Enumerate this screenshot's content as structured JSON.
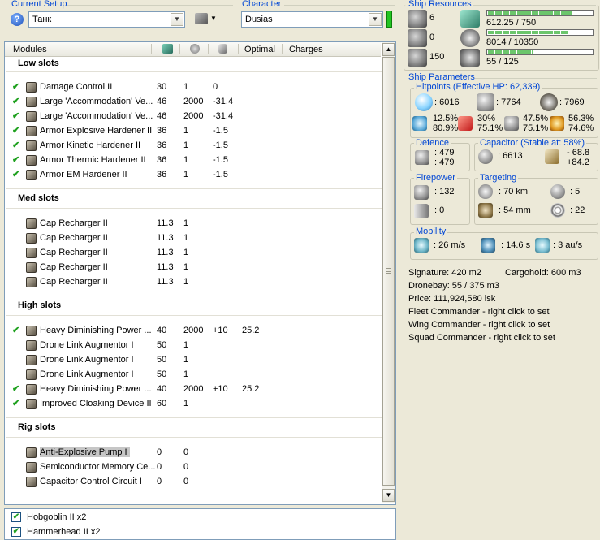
{
  "current_setup": {
    "title": "Current Setup",
    "value": "Танк"
  },
  "character": {
    "title": "Character",
    "value": "Dusias"
  },
  "ship_resources": {
    "title": "Ship Resources",
    "turrets": "6",
    "launchers": "0",
    "drone_bay": "150",
    "cpu_text": "612.25 / 750",
    "cpu_fraction": 0.816,
    "powergrid_text": "8014 / 10350",
    "powergrid_fraction": 0.774,
    "calibration_text": "55 / 125",
    "calibration_fraction": 0.44
  },
  "modules_table": {
    "headers": {
      "modules": "Modules",
      "optimal": "Optimal",
      "charges": "Charges"
    },
    "sections": [
      {
        "title": "Low slots",
        "rows": [
          {
            "checked": true,
            "name": "Damage Control II",
            "c1": "30",
            "c2": "1",
            "c3": "0",
            "optimal": ""
          },
          {
            "checked": true,
            "name": "Large 'Accommodation' Ve...",
            "c1": "46",
            "c2": "2000",
            "c3": "-31.4",
            "optimal": ""
          },
          {
            "checked": true,
            "name": "Large 'Accommodation' Ve...",
            "c1": "46",
            "c2": "2000",
            "c3": "-31.4",
            "optimal": ""
          },
          {
            "checked": true,
            "name": "Armor Explosive Hardener II",
            "c1": "36",
            "c2": "1",
            "c3": "-1.5",
            "optimal": ""
          },
          {
            "checked": true,
            "name": "Armor Kinetic Hardener II",
            "c1": "36",
            "c2": "1",
            "c3": "-1.5",
            "optimal": ""
          },
          {
            "checked": true,
            "name": "Armor Thermic Hardener II",
            "c1": "36",
            "c2": "1",
            "c3": "-1.5",
            "optimal": ""
          },
          {
            "checked": true,
            "name": "Armor EM Hardener II",
            "c1": "36",
            "c2": "1",
            "c3": "-1.5",
            "optimal": ""
          }
        ]
      },
      {
        "title": "Med slots",
        "rows": [
          {
            "checked": false,
            "name": "Cap Recharger II",
            "c1": "11.3",
            "c2": "1",
            "c3": "",
            "optimal": ""
          },
          {
            "checked": false,
            "name": "Cap Recharger II",
            "c1": "11.3",
            "c2": "1",
            "c3": "",
            "optimal": ""
          },
          {
            "checked": false,
            "name": "Cap Recharger II",
            "c1": "11.3",
            "c2": "1",
            "c3": "",
            "optimal": ""
          },
          {
            "checked": false,
            "name": "Cap Recharger II",
            "c1": "11.3",
            "c2": "1",
            "c3": "",
            "optimal": ""
          },
          {
            "checked": false,
            "name": "Cap Recharger II",
            "c1": "11.3",
            "c2": "1",
            "c3": "",
            "optimal": ""
          }
        ]
      },
      {
        "title": "High slots",
        "rows": [
          {
            "checked": true,
            "name": "Heavy Diminishing Power ...",
            "c1": "40",
            "c2": "2000",
            "c3": "+10",
            "optimal": "25.2"
          },
          {
            "checked": false,
            "name": "Drone Link Augmentor I",
            "c1": "50",
            "c2": "1",
            "c3": "",
            "optimal": ""
          },
          {
            "checked": false,
            "name": "Drone Link Augmentor I",
            "c1": "50",
            "c2": "1",
            "c3": "",
            "optimal": ""
          },
          {
            "checked": false,
            "name": "Drone Link Augmentor I",
            "c1": "50",
            "c2": "1",
            "c3": "",
            "optimal": ""
          },
          {
            "checked": true,
            "name": "Heavy Diminishing Power ...",
            "c1": "40",
            "c2": "2000",
            "c3": "+10",
            "optimal": "25.2"
          },
          {
            "checked": true,
            "name": "Improved Cloaking Device II",
            "c1": "60",
            "c2": "1",
            "c3": "",
            "optimal": ""
          }
        ]
      },
      {
        "title": "Rig slots",
        "rows": [
          {
            "checked": false,
            "name": "Anti-Explosive Pump I",
            "c1": "0",
            "c2": "0",
            "c3": "",
            "optimal": "",
            "selected": true
          },
          {
            "checked": false,
            "name": "Semiconductor Memory Ce...",
            "c1": "0",
            "c2": "0",
            "c3": "",
            "optimal": ""
          },
          {
            "checked": false,
            "name": "Capacitor Control Circuit I",
            "c1": "0",
            "c2": "0",
            "c3": "",
            "optimal": ""
          }
        ]
      }
    ]
  },
  "drones": [
    {
      "label": "Hobgoblin II x2",
      "checked": true
    },
    {
      "label": "Hammerhead II x2",
      "checked": true
    }
  ],
  "ship_parameters": {
    "title": "Ship Parameters",
    "hitpoints": {
      "title": "Hitpoints (Effective HP: 62,339)",
      "shield": ": 6016",
      "armor": ": 7764",
      "hull": ": 7969",
      "res_em": "12.5%\n80.9%",
      "res_em_top": "12.5%",
      "res_em_bottom": "80.9%",
      "res_thermal_top": "30%",
      "res_thermal_bottom": "75.1%",
      "res_kinetic_top": "47.5%",
      "res_kinetic_bottom": "75.1%",
      "res_explosive_top": "56.3%",
      "res_explosive_bottom": "74.6%"
    },
    "defence": {
      "title": "Defence",
      "top": ": 479",
      "bottom": ": 479"
    },
    "capacitor": {
      "title": "Capacitor (Stable at: 58%)",
      "amount": ": 6613",
      "top": "- 68.8",
      "bottom": "+84.2"
    },
    "firepower": {
      "title": "Firepower",
      "turret": ": 132",
      "missile": ": 0"
    },
    "targeting": {
      "title": "Targeting",
      "range": ": 70 km",
      "targets": ": 5",
      "scan_res": ": 54 mm",
      "sensor": ": 22"
    },
    "mobility": {
      "title": "Mobility",
      "speed": ": 26 m/s",
      "align": ": 14.6 s",
      "warp": ": 3 au/s"
    },
    "signature": "Signature: 420 m2",
    "cargohold": "Cargohold: 600 m3",
    "dronebay": "Dronebay: 55 / 375 m3",
    "price": "Price: 111,924,580 isk",
    "fleet_commander": "Fleet Commander - right click to set",
    "wing_commander": "Wing Commander - right click to set",
    "squad_commander": "Squad Commander - right click to set"
  }
}
